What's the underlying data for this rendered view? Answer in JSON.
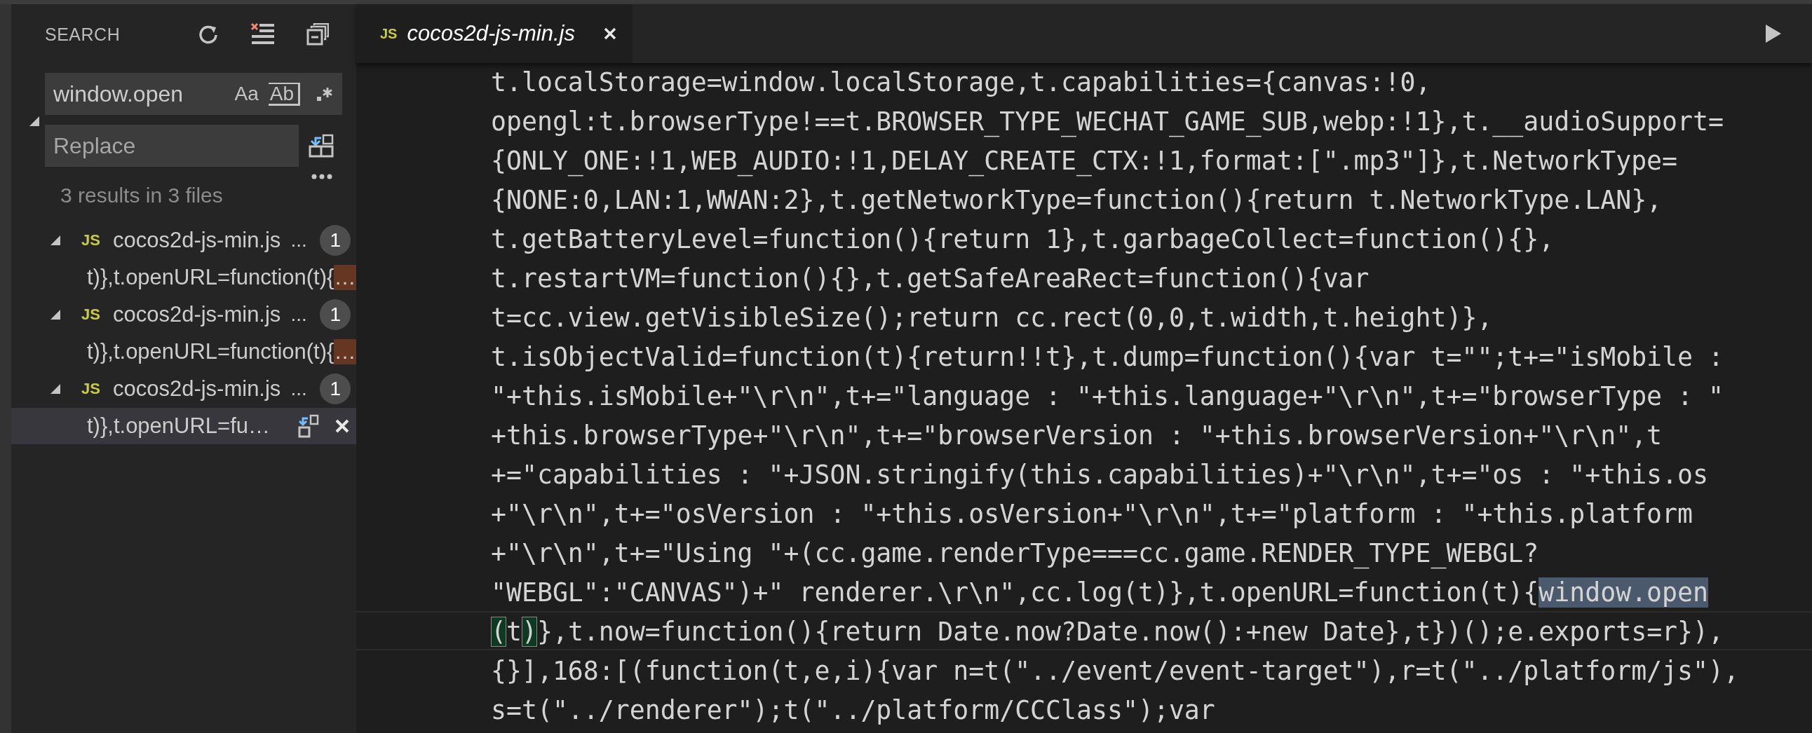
{
  "sidebar": {
    "title": "SEARCH",
    "search": {
      "value": "window.open",
      "options": [
        {
          "label": "Aa"
        },
        {
          "label": "Ab"
        }
      ]
    },
    "replace": {
      "placeholder": "Replace"
    },
    "replace_expanded": true,
    "summary": "3 results in 3 files",
    "files": [
      {
        "lang_badge": "JS",
        "name": "cocos2d-js-min.js",
        "path": "...",
        "count": "1",
        "expanded": true,
        "matches": [
          {
            "before": "t)},t.openURL=function(t){",
            "match": "…",
            "selected": false
          }
        ]
      },
      {
        "lang_badge": "JS",
        "name": "cocos2d-js-min.js",
        "path": "...",
        "count": "1",
        "expanded": true,
        "matches": [
          {
            "before": "t)},t.openURL=function(t){",
            "match": "…",
            "selected": false
          }
        ]
      },
      {
        "lang_badge": "JS",
        "name": "cocos2d-js-min.js",
        "path": "...",
        "count": "1",
        "expanded": true,
        "matches": [
          {
            "before": "t)},t.openURL=fu…",
            "selected": true
          }
        ]
      }
    ]
  },
  "editor": {
    "tabs": [
      {
        "lang_badge": "JS",
        "title": "cocos2d-js-min.js",
        "selected": true
      }
    ],
    "lines": [
      {
        "current": false,
        "parts": [
          {
            "kind": "plain",
            "text": "t.localStorage=window.localStorage,t.capabilities={canvas:!0,"
          }
        ]
      },
      {
        "current": false,
        "parts": [
          {
            "kind": "plain",
            "text": "opengl:t.browserType!==t.BROWSER_TYPE_WECHAT_GAME_SUB,webp:!1},t.__audioSupport="
          }
        ]
      },
      {
        "current": false,
        "parts": [
          {
            "kind": "plain",
            "text": "{ONLY_ONE:!1,WEB_AUDIO:!1,DELAY_CREATE_CTX:!1,format:[\".mp3\"]},t.NetworkType="
          }
        ]
      },
      {
        "current": false,
        "parts": [
          {
            "kind": "plain",
            "text": "{NONE:0,LAN:1,WWAN:2},t.getNetworkType=function(){return t.NetworkType.LAN},"
          }
        ]
      },
      {
        "current": false,
        "parts": [
          {
            "kind": "plain",
            "text": "t.getBatteryLevel=function(){return 1},t.garbageCollect=function(){},"
          }
        ]
      },
      {
        "current": false,
        "parts": [
          {
            "kind": "plain",
            "text": "t.restartVM=function(){},t.getSafeAreaRect=function(){var"
          }
        ]
      },
      {
        "current": false,
        "parts": [
          {
            "kind": "plain",
            "text": "t=cc.view.getVisibleSize();return cc.rect(0,0,t.width,t.height)},"
          }
        ]
      },
      {
        "current": false,
        "parts": [
          {
            "kind": "plain",
            "text": "t.isObjectValid=function(t){return!!t},t.dump=function(){var t=\"\";t+=\"isMobile :"
          }
        ]
      },
      {
        "current": false,
        "parts": [
          {
            "kind": "plain",
            "text": "\"+this.isMobile+\"\\r\\n\",t+=\"language : \"+this.language+\"\\r\\n\",t+=\"browserType : \""
          }
        ]
      },
      {
        "current": false,
        "parts": [
          {
            "kind": "plain",
            "text": "+this.browserType+\"\\r\\n\",t+=\"browserVersion : \"+this.browserVersion+\"\\r\\n\",t"
          }
        ]
      },
      {
        "current": false,
        "parts": [
          {
            "kind": "plain",
            "text": "+=\"capabilities : \"+JSON.stringify(this.capabilities)+\"\\r\\n\",t+=\"os : \"+this.os"
          }
        ]
      },
      {
        "current": false,
        "parts": [
          {
            "kind": "plain",
            "text": "+\"\\r\\n\",t+=\"osVersion : \"+this.osVersion+\"\\r\\n\",t+=\"platform : \"+this.platform"
          }
        ]
      },
      {
        "current": false,
        "parts": [
          {
            "kind": "plain",
            "text": "+\"\\r\\n\",t+=\"Using \"+(cc.game.renderType===cc.game.RENDER_TYPE_WEBGL?"
          }
        ]
      },
      {
        "current": false,
        "parts": [
          {
            "kind": "plain",
            "text": "\"WEBGL\":\"CANVAS\")+\" renderer.\\r\\n\",cc.log(t)},t.openURL=function(t){"
          },
          {
            "kind": "match",
            "text": "window.open"
          }
        ]
      },
      {
        "current": true,
        "parts": [
          {
            "kind": "bracket",
            "text": "("
          },
          {
            "kind": "plain",
            "text": "t"
          },
          {
            "kind": "bracket",
            "text": ")"
          },
          {
            "kind": "plain",
            "text": "},t.now=function(){return Date.now?Date.now():+new Date},t})();e.exports=r}),"
          }
        ]
      },
      {
        "current": false,
        "parts": [
          {
            "kind": "plain",
            "text": "{}],168:[(function(t,e,i){var n=t(\"../event/event-target\"),r=t(\"../platform/js\"),"
          }
        ]
      },
      {
        "current": false,
        "parts": [
          {
            "kind": "plain",
            "text": "s=t(\"../renderer\");t(\"../platform/CCClass\");var"
          }
        ]
      }
    ]
  }
}
